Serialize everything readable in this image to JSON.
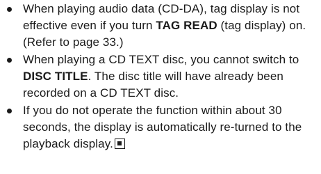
{
  "notes": [
    {
      "segments": [
        {
          "text": "When playing audio data (CD-DA), tag display is not effective even if you turn ",
          "bold": false
        },
        {
          "text": "TAG READ",
          "bold": true
        },
        {
          "text": " (tag display) on. (Refer to page 33.)",
          "bold": false
        }
      ],
      "end_mark": false
    },
    {
      "segments": [
        {
          "text": "When playing a CD TEXT disc, you cannot switch to ",
          "bold": false
        },
        {
          "text": "DISC TITLE",
          "bold": true
        },
        {
          "text": ". The disc title will have already been recorded on a CD TEXT disc.",
          "bold": false
        }
      ],
      "end_mark": false
    },
    {
      "segments": [
        {
          "text": "If you do not operate the function within about 30 seconds, the display is automatically re-turned to the playback display.",
          "bold": false
        }
      ],
      "end_mark": true,
      "end_mark_icon": "end-of-section-mark-icon"
    }
  ]
}
